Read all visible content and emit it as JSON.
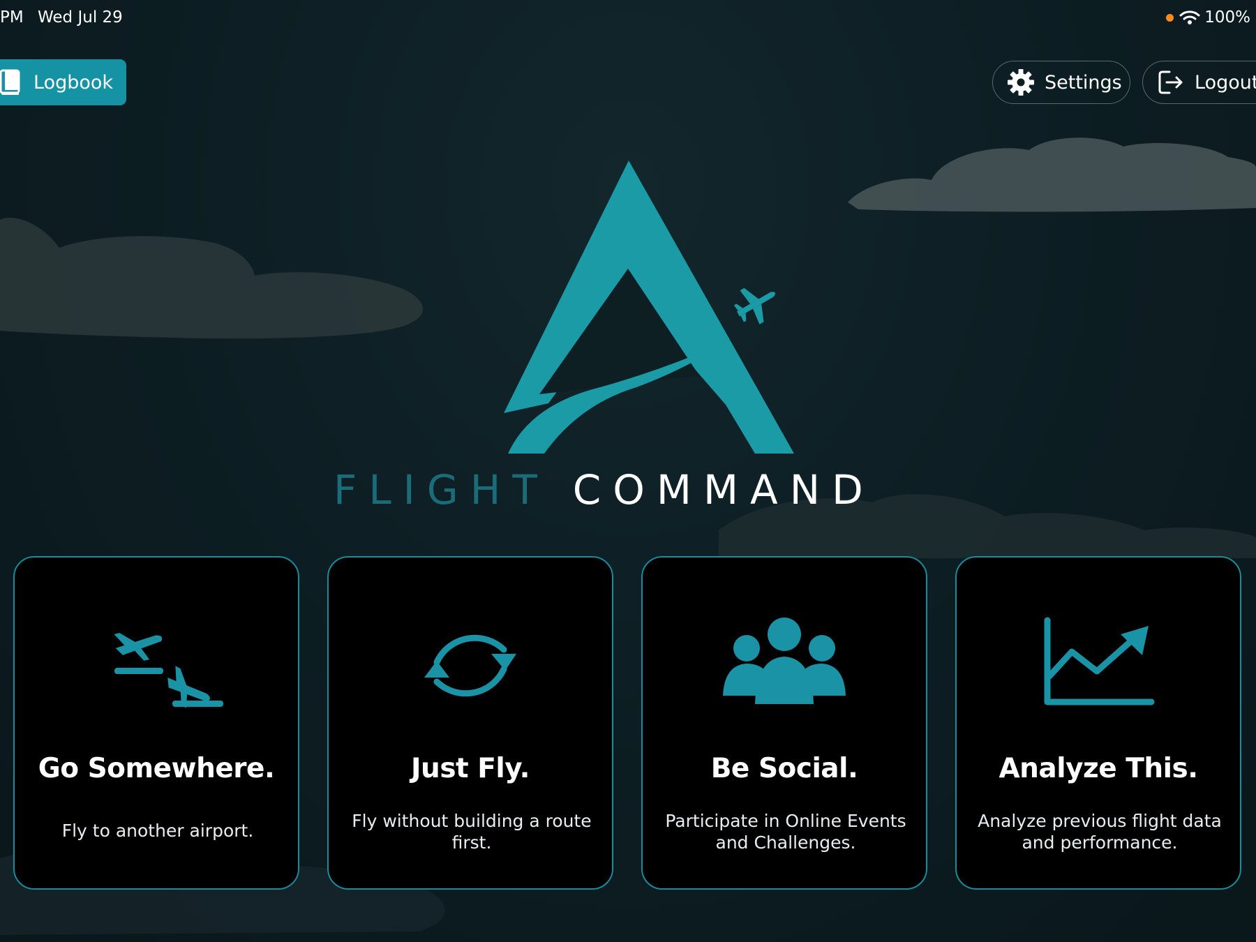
{
  "status_bar": {
    "time": "PM",
    "date": "Wed Jul 29",
    "battery": "100%",
    "icons": [
      "recording-dot",
      "wifi-icon"
    ]
  },
  "header": {
    "logbook_label": "Logbook",
    "settings_label": "Settings",
    "logout_label": "Logout",
    "icons": {
      "logbook": "book-icon",
      "settings": "gear-icon",
      "logout": "logout-icon"
    }
  },
  "brand": {
    "word1": "FLIGHT",
    "word2": "COMMAND",
    "colors": {
      "accent": "#1a9ba6",
      "word1": "#1a6d78",
      "word2": "#ffffff"
    }
  },
  "cards": [
    {
      "title": "Go Somewhere.",
      "description": "Fly to another airport.",
      "icon": "departure-arrival-icon"
    },
    {
      "title": "Just Fly.",
      "description": "Fly without building a route first.",
      "icon": "refresh-cycle-icon"
    },
    {
      "title": "Be Social.",
      "description": "Participate in Online Events and Challenges.",
      "icon": "people-group-icon"
    },
    {
      "title": "Analyze This.",
      "description": "Analyze previous flight data and performance.",
      "icon": "chart-trend-icon"
    }
  ],
  "theme": {
    "accent": "#1592a3",
    "background": "#0c1d22",
    "card_border": "#178c9c",
    "icon_color": "#1a93a6"
  }
}
